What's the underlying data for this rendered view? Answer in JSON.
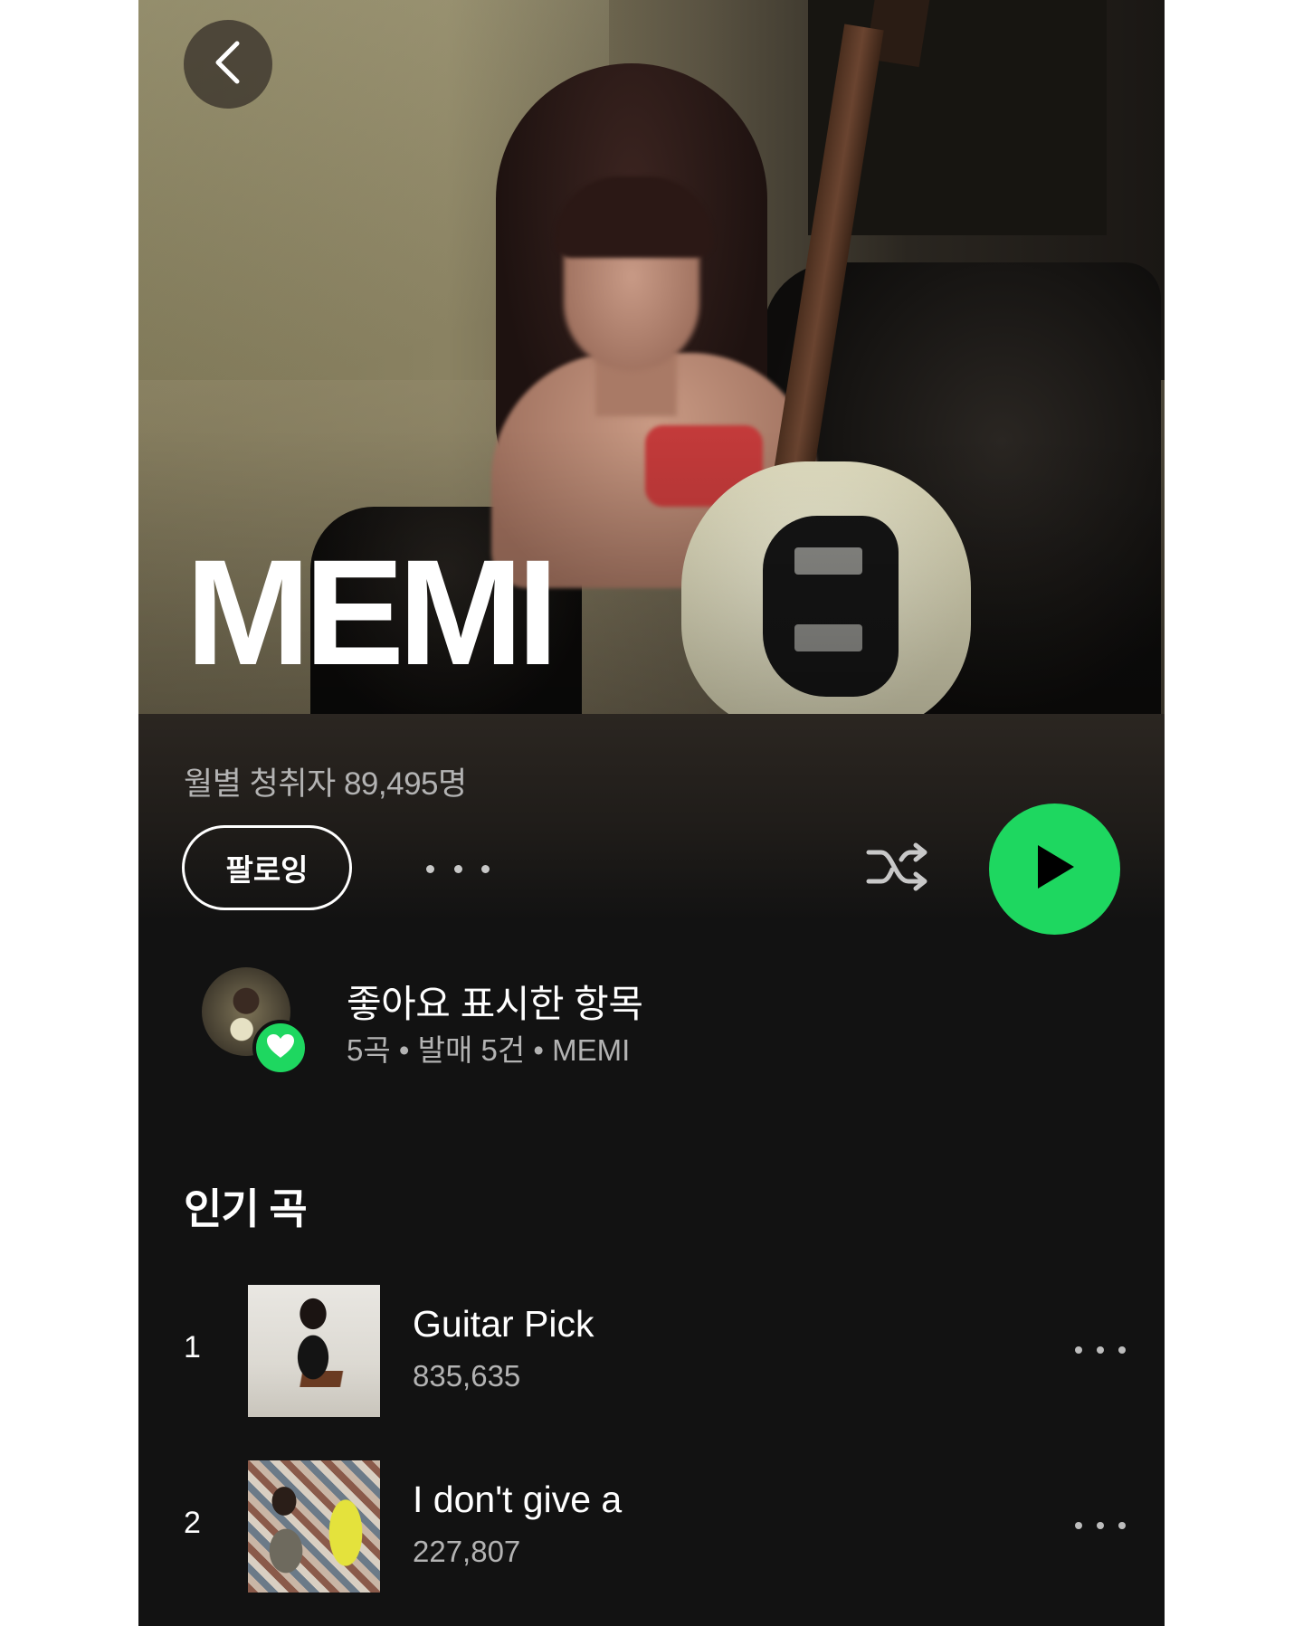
{
  "artist": {
    "name": "MEMI",
    "monthly_listeners": "월별 청취자 89,495명"
  },
  "actions": {
    "follow_label": "팔로잉",
    "play_color": "#1ed760"
  },
  "liked": {
    "title": "좋아요 표시한 항목",
    "subtitle": "5곡 • 발매 5건 • MEMI"
  },
  "popular": {
    "title": "인기 곡",
    "tracks": [
      {
        "rank": "1",
        "title": "Guitar Pick",
        "plays": "835,635"
      },
      {
        "rank": "2",
        "title": "I don't give a",
        "plays": "227,807"
      }
    ]
  },
  "icons": {
    "back": "chevron-left-icon",
    "more": "more-horizontal-icon",
    "shuffle": "shuffle-icon",
    "play": "play-icon",
    "heart": "heart-icon"
  }
}
